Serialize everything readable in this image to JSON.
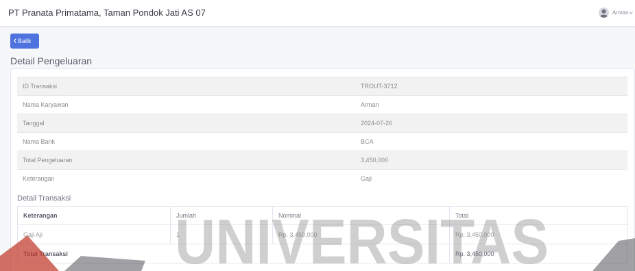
{
  "header": {
    "company_name": "PT Pranata Primatama, Taman Pondok Jati AS 07",
    "user_name": "Arman"
  },
  "page": {
    "back_label": "Balik",
    "title": "Detail Pengeluaran"
  },
  "details": [
    {
      "label": "ID Transaksi",
      "value": "TROUT-3712"
    },
    {
      "label": "Nama Karyawan",
      "value": "Arman"
    },
    {
      "label": "Tanggal",
      "value": "2024-07-26"
    },
    {
      "label": "Nama Bank",
      "value": "BCA"
    },
    {
      "label": "Total Pengeluaran",
      "value": "3,450,000"
    },
    {
      "label": "Keterangan",
      "value": "Gaji"
    }
  ],
  "transactions": {
    "section_title": "Detail Transaksi",
    "columns": [
      "Keterangan",
      "Jumlah",
      "Nominal",
      "Total"
    ],
    "rows": [
      {
        "keterangan": "Gaji Aji",
        "jumlah": "1",
        "nominal": "Rp. 3,450,000",
        "total": "Rp. 3,450,000"
      }
    ],
    "footer": {
      "label": "Total Transaksi",
      "total": "Rp. 3,450,000"
    }
  },
  "watermark": {
    "text": "UNIVERSITAS"
  },
  "icons": {
    "avatar": "user-avatar-icon",
    "user_menu": "chevron-down-icon",
    "back": "chevron-left-icon"
  },
  "colors": {
    "primary": "#4e73df",
    "watermark_red": "#c0392b"
  }
}
